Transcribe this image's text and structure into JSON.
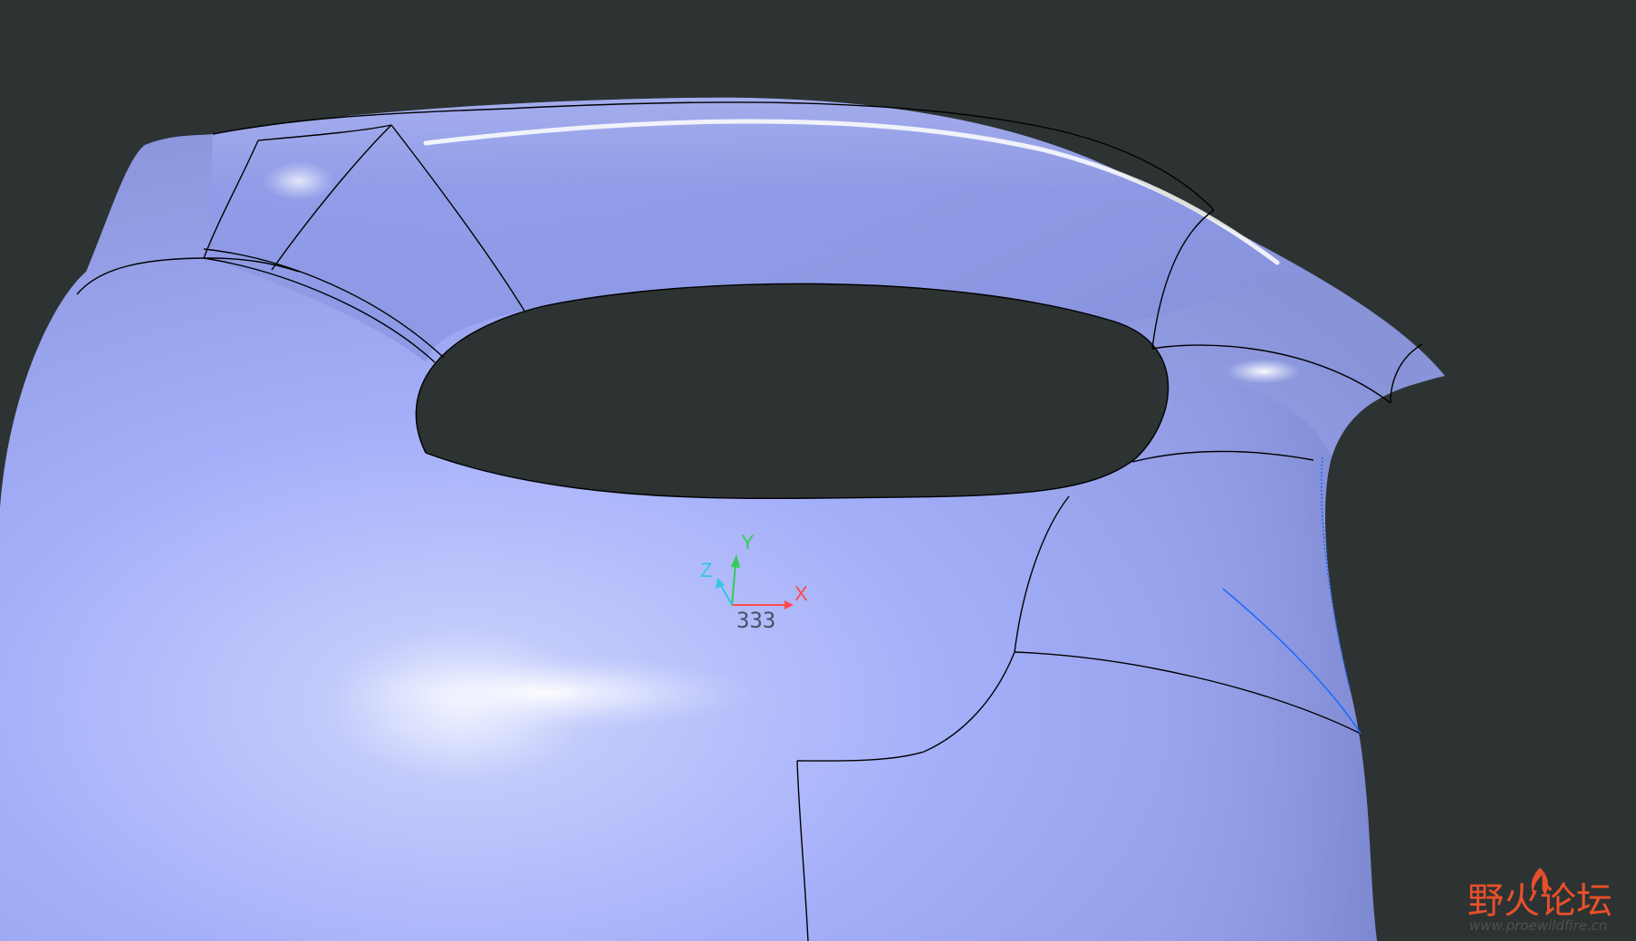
{
  "viewport": {
    "background": "#2d3333",
    "model_color": "#a7b2ee",
    "edge_color": "#000000",
    "selected_edge_color": "#1e6bff"
  },
  "triad": {
    "x_label": "X",
    "y_label": "Y",
    "z_label": "Z",
    "x_color": "#ff4a4a",
    "y_color": "#33cc55",
    "z_color": "#33c6e6",
    "csys_name": "333"
  },
  "watermark": {
    "brand": "野火论坛",
    "url": "www.proewildfire.cn",
    "brand_color": "#e8502a",
    "icon": "flame-icon"
  }
}
